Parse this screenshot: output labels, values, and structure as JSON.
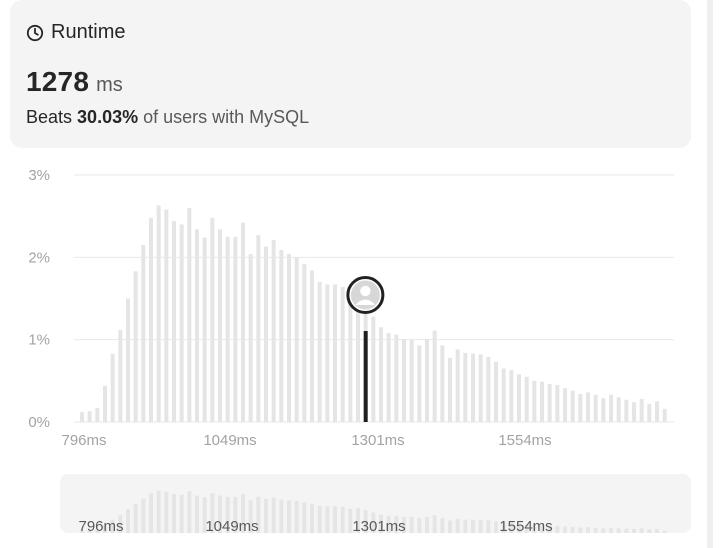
{
  "summary": {
    "title": "Runtime",
    "value": "1278",
    "unit": "ms",
    "beats_label": "Beats",
    "beats_percent": "30.03%",
    "beats_suffix": "of users with MySQL"
  },
  "icons": {
    "runtime": "clock-icon",
    "user_marker": "avatar-icon"
  },
  "colors": {
    "card_background": "#f4f4f4",
    "bar": "#e5e5e5",
    "selected_marker": "#1f1f1f",
    "axis_text": "#a3a3a3"
  },
  "chart_data": {
    "type": "bar",
    "title": "",
    "xlabel": "",
    "ylabel": "",
    "ylim": [
      0,
      3
    ],
    "y_ticks": [
      "0%",
      "1%",
      "2%",
      "3%"
    ],
    "x_ticks": [
      "796ms",
      "1049ms",
      "1301ms",
      "1554ms"
    ],
    "selected_runtime_ms": 1278,
    "series": [
      {
        "values": [
          0.12,
          0.13,
          0.17,
          0.44,
          0.83,
          1.12,
          1.5,
          1.83,
          2.15,
          2.48,
          2.63,
          2.58,
          2.44,
          2.4,
          2.6,
          2.34,
          2.24,
          2.48,
          2.34,
          2.25,
          2.25,
          2.42,
          2.04,
          2.27,
          2.13,
          2.21,
          2.09,
          2.04,
          2.0,
          1.92,
          1.84,
          1.7,
          1.67,
          1.67,
          1.64,
          1.51,
          1.56,
          1.42,
          1.28,
          1.15,
          1.08,
          1.06,
          1.01,
          1.0,
          0.93,
          1.01,
          1.11,
          0.93,
          0.78,
          0.88,
          0.84,
          0.83,
          0.82,
          0.79,
          0.73,
          0.65,
          0.63,
          0.58,
          0.55,
          0.5,
          0.49,
          0.46,
          0.45,
          0.41,
          0.38,
          0.34,
          0.36,
          0.33,
          0.29,
          0.33,
          0.3,
          0.27,
          0.24,
          0.28,
          0.22,
          0.25,
          0.16
        ]
      }
    ],
    "overview_x_ticks": [
      "796ms",
      "1049ms",
      "1301ms",
      "1554ms"
    ]
  }
}
